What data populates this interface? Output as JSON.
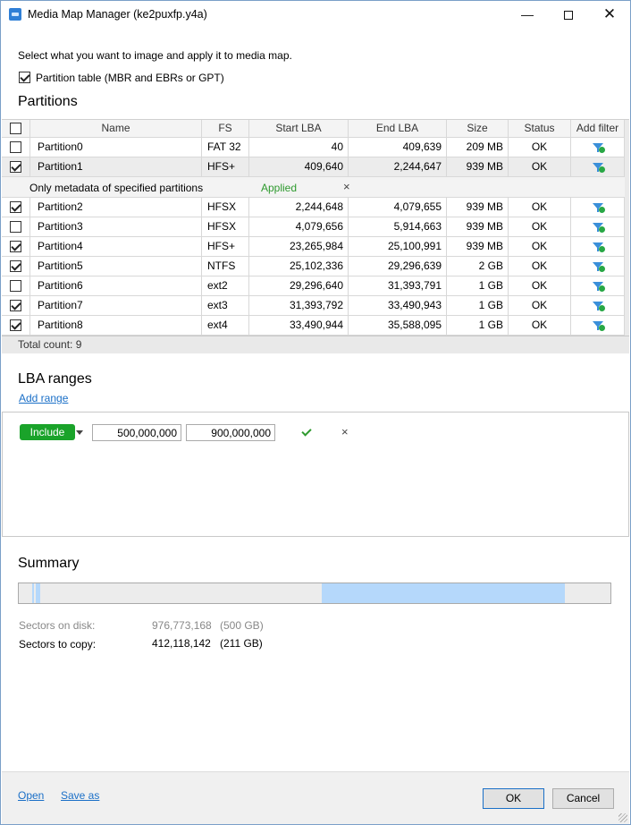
{
  "window": {
    "title": "Media Map Manager (ke2puxfp.y4a)"
  },
  "instruction": "Select what you want to image and apply it to media map.",
  "partition_table": {
    "label": "Partition table (MBR and EBRs or GPT)",
    "checked": true
  },
  "partitions": {
    "title": "Partitions",
    "columns": {
      "name": "Name",
      "fs": "FS",
      "start": "Start LBA",
      "end": "End LBA",
      "size": "Size",
      "status": "Status",
      "filter": "Add filter"
    },
    "rows": [
      {
        "name": "Partition0",
        "fs": "FAT 32",
        "start": "40",
        "end": "409,639",
        "size": "209 MB",
        "status": "OK",
        "checked": false
      },
      {
        "name": "Partition1",
        "fs": "HFS+",
        "start": "409,640",
        "end": "2,244,647",
        "size": "939 MB",
        "status": "OK",
        "checked": true
      },
      {
        "name": "Partition2",
        "fs": "HFSX",
        "start": "2,244,648",
        "end": "4,079,655",
        "size": "939 MB",
        "status": "OK",
        "checked": true
      },
      {
        "name": "Partition3",
        "fs": "HFSX",
        "start": "4,079,656",
        "end": "5,914,663",
        "size": "939 MB",
        "status": "OK",
        "checked": false
      },
      {
        "name": "Partition4",
        "fs": "HFS+",
        "start": "23,265,984",
        "end": "25,100,991",
        "size": "939 MB",
        "status": "OK",
        "checked": true
      },
      {
        "name": "Partition5",
        "fs": "NTFS",
        "start": "25,102,336",
        "end": "29,296,639",
        "size": "2 GB",
        "status": "OK",
        "checked": true
      },
      {
        "name": "Partition6",
        "fs": "ext2",
        "start": "29,296,640",
        "end": "31,393,791",
        "size": "1 GB",
        "status": "OK",
        "checked": false
      },
      {
        "name": "Partition7",
        "fs": "ext3",
        "start": "31,393,792",
        "end": "33,490,943",
        "size": "1 GB",
        "status": "OK",
        "checked": true
      },
      {
        "name": "Partition8",
        "fs": "ext4",
        "start": "33,490,944",
        "end": "35,588,095",
        "size": "1 GB",
        "status": "OK",
        "checked": true
      }
    ],
    "subfilter": {
      "label": "Only metadata of specified partitions",
      "status": "Applied",
      "remove": "×"
    },
    "total_label": "Total count:",
    "total_count": "9"
  },
  "lba_ranges": {
    "title": "LBA ranges",
    "add_link": "Add range",
    "range": {
      "mode": "Include",
      "start": "500,000,000",
      "end": "900,000,000",
      "remove": "×"
    }
  },
  "summary": {
    "title": "Summary",
    "sectors_on_disk_label": "Sectors on disk:",
    "sectors_on_disk": "976,773,168",
    "sectors_on_disk_size": "(500 GB)",
    "sectors_to_copy_label": "Sectors to copy:",
    "sectors_to_copy": "412,118,142",
    "sectors_to_copy_size": "(211 GB)"
  },
  "footer": {
    "open": "Open",
    "save_as": "Save as",
    "ok": "OK",
    "cancel": "Cancel"
  },
  "colors": {
    "accent_link": "#1a6fc7",
    "include_green": "#1aa32a",
    "applied_green": "#2e9a2e",
    "bar_fill": "#b5d8fb"
  }
}
